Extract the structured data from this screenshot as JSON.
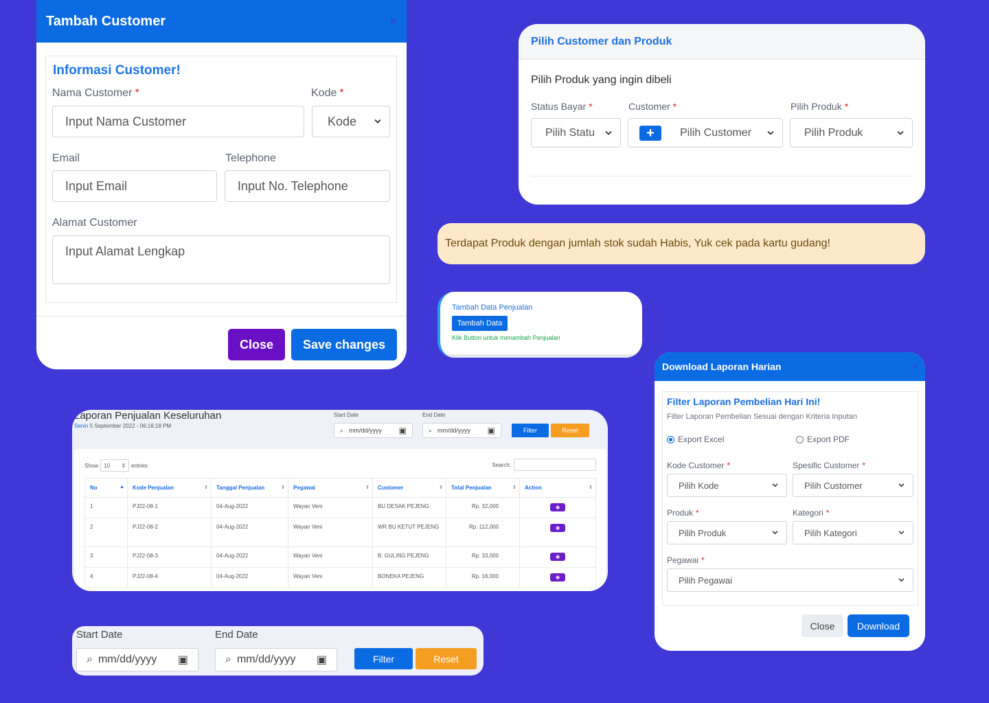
{
  "tambah_customer": {
    "title": "Tambah Customer",
    "close_x": "×",
    "section_title": "Informasi Customer!",
    "nama_label": "Nama Customer",
    "nama_placeholder": "Input Nama Customer",
    "kode_label": "Kode",
    "kode_value": "Kode",
    "email_label": "Email",
    "email_placeholder": "Input Email",
    "telephone_label": "Telephone",
    "telephone_placeholder": "Input No. Telephone",
    "alamat_label": "Alamat Customer",
    "alamat_placeholder": "Input Alamat Lengkap",
    "close_button": "Close",
    "save_button": "Save changes",
    "required_mark": "*"
  },
  "pilih_customer": {
    "title": "Pilih Customer dan Produk",
    "subtitle": "Pilih Produk yang ingin dibeli",
    "status_label": "Status Bayar",
    "status_value": "Pilih Statu",
    "customer_label": "Customer",
    "customer_value": "Pilih Customer",
    "produk_label": "Pilih Produk",
    "produk_value": "Pilih Produk",
    "add_symbol": "+"
  },
  "alert": {
    "message": "Terdapat Produk dengan jumlah stok sudah Habis, Yuk cek pada kartu gudang!"
  },
  "tambah_data": {
    "title": "Tambah Data Penjualan",
    "button": "Tambah Data",
    "note": "Klik Button untuk menambah Penjualan"
  },
  "download_laporan": {
    "title": "Download Laporan Harian",
    "close_x": "×",
    "filter_title": "Filter Laporan Pembelian Hari Ini!",
    "filter_subtitle": "Filter Laporan Pembelian Sesuai dengan Kriteria Inputan",
    "export_excel": "Export Excel",
    "export_pdf": "Export PDF",
    "kode_label": "Kode Customer",
    "kode_value": "Pilih Kode",
    "spesific_label": "Spesific Customer",
    "spesific_value": "Pilih Customer",
    "produk_label": "Produk",
    "produk_value": "Pilih Produk",
    "kategori_label": "Kategori",
    "kategori_value": "Pilih Kategori",
    "pegawai_label": "Pegawai",
    "pegawai_value": "Pilih Pegawai",
    "close_button": "Close",
    "download_button": "Download"
  },
  "laporan": {
    "title": "Laporan Penjualan Keseluruhan",
    "day": "Senin",
    "date": "5 September 2022 - 06:16:18 PM",
    "start_label": "Start Date",
    "end_label": "End Date",
    "date_placeholder": "mm/dd/yyyy",
    "filter_button": "Filter",
    "reset_button": "Reset",
    "show_label": "Show",
    "show_value": "10",
    "entries_label": "entries",
    "search_label": "Search:",
    "columns": [
      "No",
      "Kode Penjualan",
      "Tanggal Penjualan",
      "Pegawai",
      "Customer",
      "Total Penjualan",
      "Action"
    ],
    "rows": [
      {
        "no": "1",
        "kode": "PJ22-08-1",
        "tanggal": "04-Aug-2022",
        "pegawai": "Wayan Veni",
        "customer": "BU DESAK PEJENG",
        "total": "Rp. 32,000"
      },
      {
        "no": "2",
        "kode": "PJ22-08-2",
        "tanggal": "04-Aug-2022",
        "pegawai": "Wayan Veni",
        "customer": "WR BU KETUT PEJENG",
        "total": "Rp. 112,000"
      },
      {
        "no": "3",
        "kode": "PJ22-08-3",
        "tanggal": "04-Aug-2022",
        "pegawai": "Wayan Veni",
        "customer": "B. GULING PEJENG",
        "total": "Rp. 33,000"
      },
      {
        "no": "4",
        "kode": "PJ22-08-4",
        "tanggal": "04-Aug-2022",
        "pegawai": "Wayan Veni",
        "customer": "BONEKA PEJENG",
        "total": "Rp. 16,000"
      }
    ]
  },
  "date_filter": {
    "start_label": "Start Date",
    "end_label": "End Date",
    "date_placeholder": "mm/dd/yyyy",
    "filter_button": "Filter",
    "reset_button": "Reset"
  },
  "colors": {
    "background": "#3f37d6",
    "primary": "#0b6be2",
    "purple": "#6a0fc4",
    "orange": "#f59e22",
    "alert_bg": "#fde9c9"
  }
}
